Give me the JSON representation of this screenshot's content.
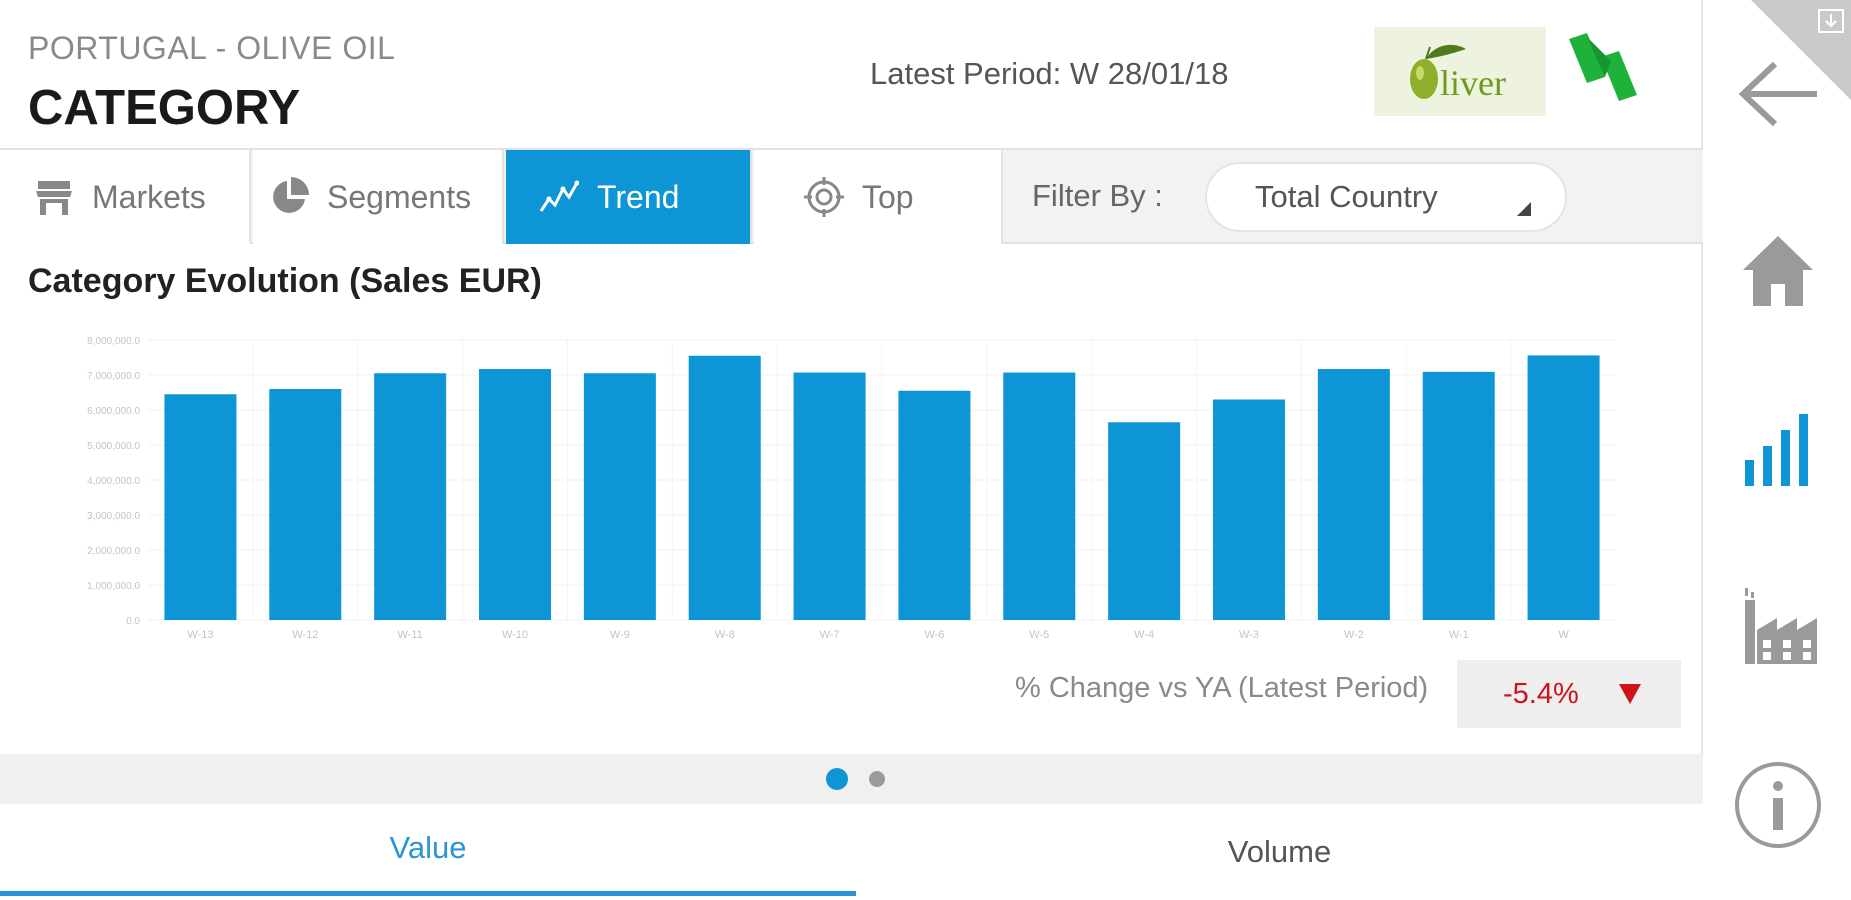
{
  "header": {
    "region": "PORTUGAL - OLIVE OIL",
    "title": "CATEGORY",
    "latest_period": "Latest Period: W 28/01/18",
    "brand_logo_text": "liver"
  },
  "tabs": [
    {
      "label": "Markets",
      "icon": "store-icon",
      "active": false
    },
    {
      "label": "Segments",
      "icon": "pie-chart-icon",
      "active": false
    },
    {
      "label": "Trend",
      "icon": "trend-line-icon",
      "active": true
    },
    {
      "label": "Top",
      "icon": "target-icon",
      "active": false
    }
  ],
  "filter": {
    "label": "Filter By :",
    "selected": "Total Country"
  },
  "chart_data": {
    "type": "bar",
    "title": "Category Evolution (Sales EUR)",
    "xlabel": "",
    "ylabel": "",
    "categories": [
      "W-13",
      "W-12",
      "W-11",
      "W-10",
      "W-9",
      "W-8",
      "W-7",
      "W-6",
      "W-5",
      "W-4",
      "W-3",
      "W-2",
      "W-1",
      "W"
    ],
    "values": [
      6450000,
      6600000,
      7050000,
      7170000,
      7050000,
      7550000,
      7070000,
      6550000,
      7070000,
      5650000,
      6300000,
      7170000,
      7090000,
      7560000
    ],
    "ylim": [
      0,
      8000000
    ],
    "yticks": [
      "0.0",
      "1,000,000.0",
      "2,000,000.0",
      "3,000,000.0",
      "4,000,000.0",
      "5,000,000.0",
      "6,000,000.0",
      "7,000,000.0",
      "8,000,000.0"
    ],
    "grid": true,
    "color": "#0d95d6"
  },
  "change": {
    "label": "% Change vs YA (Latest Period)",
    "value": "-5.4%",
    "direction": "down",
    "color": "#d0121b"
  },
  "pager": {
    "pages": 2,
    "current": 1
  },
  "bottom_tabs": [
    {
      "label": "Value",
      "active": true
    },
    {
      "label": "Volume",
      "active": false
    }
  ],
  "sidebar": [
    "back-arrow-icon",
    "home-icon",
    "signal-bars-icon",
    "factory-icon",
    "info-icon"
  ],
  "colors": {
    "accent": "#0d95d6",
    "negative": "#d0121b"
  }
}
